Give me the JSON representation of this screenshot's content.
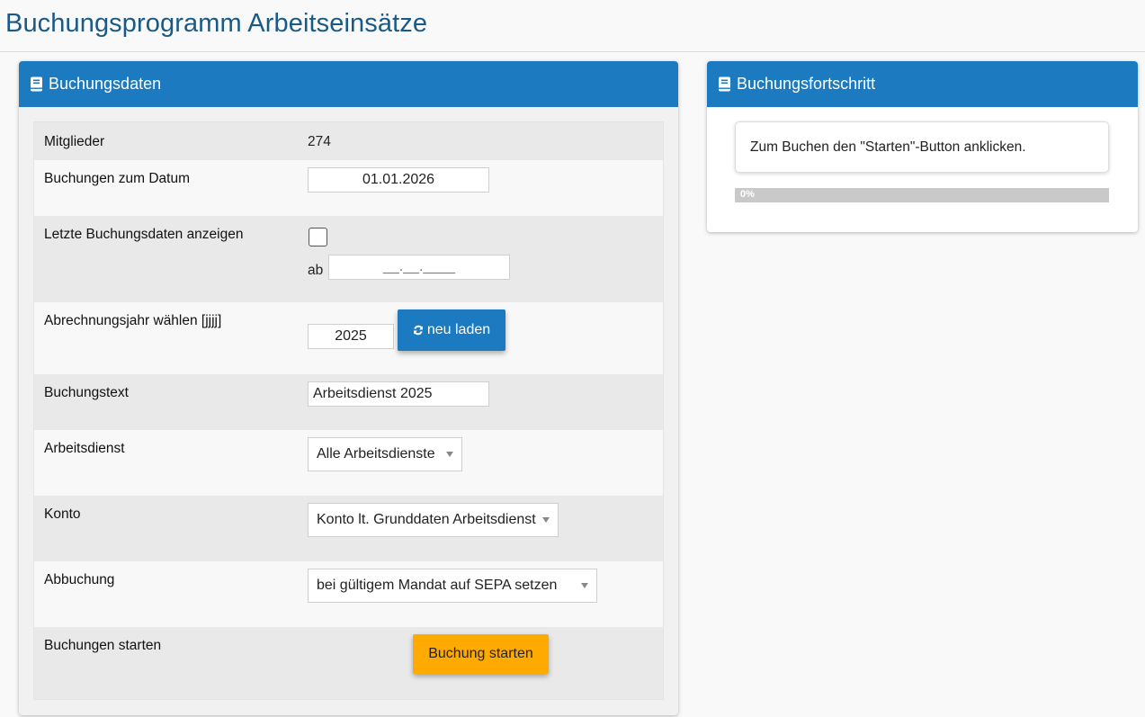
{
  "page": {
    "title": "Buchungsprogramm Arbeitseinsätze"
  },
  "left_panel": {
    "heading": "Buchungsdaten",
    "icon": "book-icon",
    "rows": {
      "mitglieder": {
        "label": "Mitglieder",
        "value": "274"
      },
      "datum": {
        "label": "Buchungen zum Datum",
        "value": "01.01.2026"
      },
      "letzte": {
        "label": "Letzte Buchungsdaten anzeigen",
        "checked": false,
        "ab_label": "ab",
        "ab_placeholder": "__.__.____"
      },
      "jahr": {
        "label": "Abrechnungsjahr wählen [jjjj]",
        "value": "2025",
        "reload_label": "neu laden",
        "reload_icon": "refresh-icon"
      },
      "text": {
        "label": "Buchungstext",
        "value": "Arbeitsdienst 2025"
      },
      "arbeitsdienst": {
        "label": "Arbeitsdienst",
        "selected": "Alle Arbeitsdienste"
      },
      "konto": {
        "label": "Konto",
        "selected": "Konto lt. Grunddaten Arbeitsdienst"
      },
      "abbuchung": {
        "label": "Abbuchung",
        "selected": "bei gültigem Mandat auf SEPA setzen"
      },
      "starten": {
        "label": "Buchungen starten",
        "button_label": "Buchung starten"
      }
    }
  },
  "right_panel": {
    "heading": "Buchungsfortschritt",
    "icon": "book-icon",
    "message": "Zum Buchen den \"Starten\"-Button anklicken.",
    "progress": {
      "value": 0,
      "label": "0%"
    }
  },
  "colors": {
    "primary": "#1b7ac0",
    "accent": "#ffaa00",
    "title": "#1a5a86"
  }
}
